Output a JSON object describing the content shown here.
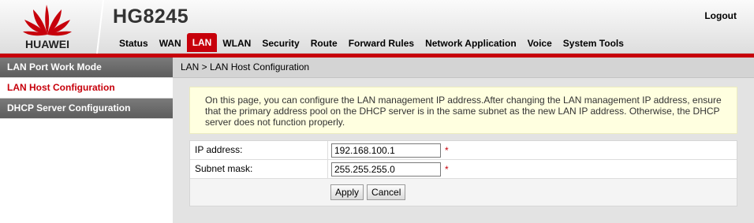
{
  "header": {
    "brand": "HUAWEI",
    "product": "HG8245",
    "logout": "Logout",
    "nav": [
      "Status",
      "WAN",
      "LAN",
      "WLAN",
      "Security",
      "Route",
      "Forward Rules",
      "Network Application",
      "Voice",
      "System Tools"
    ],
    "active_nav": "LAN",
    "accent_color": "#c7000b"
  },
  "sidebar": {
    "items": [
      {
        "label": "LAN Port Work Mode"
      },
      {
        "label": "LAN Host Configuration"
      },
      {
        "label": "DHCP Server Configuration"
      }
    ]
  },
  "main": {
    "breadcrumb": "LAN > LAN Host Configuration",
    "notice": "On this page, you can configure the LAN management IP address.After changing the LAN management IP address, ensure that the primary address pool on the DHCP server is in the same subnet as the new LAN IP address. Otherwise, the DHCP server does not function properly.",
    "fields": [
      {
        "label": "IP address:",
        "value": "192.168.100.1",
        "required": "*"
      },
      {
        "label": "Subnet mask:",
        "value": "255.255.255.0",
        "required": "*"
      }
    ],
    "buttons": {
      "apply": "Apply",
      "cancel": "Cancel"
    }
  }
}
